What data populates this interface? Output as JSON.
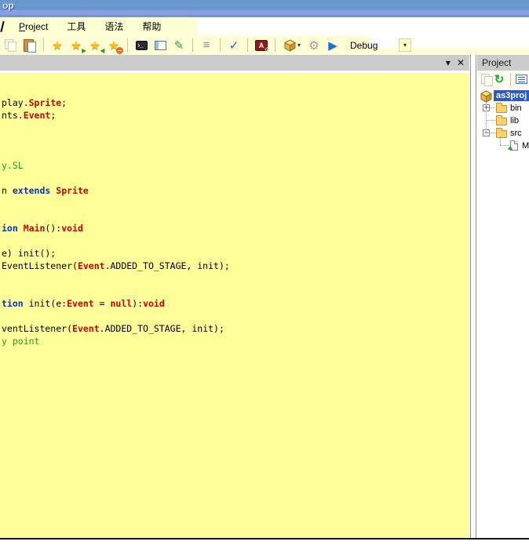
{
  "window": {
    "title": "op"
  },
  "colors": {
    "title_band": "#6898cc",
    "title_band_light": "#8d9de6",
    "bar_yellow": "#ffffd6",
    "editor_bg": "#ffff99",
    "selection_blue": "#2a5ac8",
    "keyword": "#0033cc",
    "type": "#c80000",
    "comment": "#22a022",
    "panel_gray": "#cbcbcb"
  },
  "menu": {
    "items": [
      {
        "name": "menu-item-project",
        "label": "Project",
        "underline": 0
      },
      {
        "name": "menu-item-tools",
        "label": "工具"
      },
      {
        "name": "menu-item-syntax",
        "label": "语法"
      },
      {
        "name": "menu-item-help",
        "label": "帮助"
      }
    ]
  },
  "toolbar": {
    "items": [
      {
        "name": "copy-icon",
        "kind": "copy",
        "disabled": true
      },
      {
        "name": "paste-icon",
        "kind": "paste"
      },
      {
        "name": "toolbar-separator",
        "kind": "sep"
      },
      {
        "name": "bookmark-icon",
        "kind": "star",
        "glyph": "★"
      },
      {
        "name": "next-bookmark-icon",
        "kind": "star",
        "glyph": "★",
        "overlay": "▸",
        "overlayColor": "#1fa01f"
      },
      {
        "name": "prev-bookmark-icon",
        "kind": "star",
        "glyph": "★",
        "overlay": "◂",
        "overlayColor": "#1fa01f"
      },
      {
        "name": "clear-bookmarks-icon",
        "kind": "star",
        "glyph": "★",
        "overlay": "−",
        "overlayColor": "#fff",
        "overlayBg": "#e86c1a"
      },
      {
        "name": "toolbar-separator",
        "kind": "sep"
      },
      {
        "name": "console-icon",
        "kind": "console",
        "glyph": "›_"
      },
      {
        "name": "layout-panels-icon",
        "kind": "layout"
      },
      {
        "name": "snippet-edit-icon",
        "kind": "glyph",
        "glyph": "✎",
        "color": "#3a9a3a"
      },
      {
        "name": "toolbar-separator",
        "kind": "sep"
      },
      {
        "name": "indent-icon",
        "kind": "glyph",
        "glyph": "≡",
        "color": "#8a8a8a"
      },
      {
        "name": "toolbar-separator",
        "kind": "sep"
      },
      {
        "name": "syntax-check-icon",
        "kind": "glyph",
        "glyph": "✓",
        "color": "#1b5fd0"
      },
      {
        "name": "toolbar-separator",
        "kind": "sep"
      },
      {
        "name": "flash-player-icon",
        "kind": "flash",
        "glyph": "A",
        "gear": "⚙"
      },
      {
        "name": "toolbar-separator",
        "kind": "sep"
      },
      {
        "name": "build-project-icon",
        "kind": "cube",
        "dropdown": "▾"
      },
      {
        "name": "settings-icon",
        "kind": "glyph",
        "glyph": "⚙",
        "color": "#9a9a9a"
      },
      {
        "name": "run-icon",
        "kind": "glyph",
        "glyph": "▶",
        "color": "#1b6fd0"
      }
    ],
    "debug_combo": {
      "value": "Debug",
      "arrow": "▾"
    }
  },
  "editor": {
    "header": {
      "collapse_glyph": "▾",
      "close_glyph": "✕"
    },
    "lines": [
      [
        [
          "p",
          "play."
        ],
        [
          "t",
          "Sprite"
        ],
        [
          "p",
          ";"
        ]
      ],
      [
        [
          "p",
          "nts."
        ],
        [
          "t",
          "Event"
        ],
        [
          "p",
          ";"
        ]
      ],
      [],
      [],
      [],
      [
        [
          "c",
          "y.SL"
        ]
      ],
      [],
      [
        [
          "p",
          "n "
        ],
        [
          "k",
          "extends"
        ],
        [
          "p",
          " "
        ],
        [
          "t",
          "Sprite"
        ]
      ],
      [],
      [],
      [
        [
          "k",
          "ion"
        ],
        [
          "p",
          " "
        ],
        [
          "t",
          "Main"
        ],
        [
          "p",
          "():"
        ],
        [
          "t",
          "void"
        ]
      ],
      [],
      [
        [
          "p",
          "e) init();"
        ]
      ],
      [
        [
          "p",
          "EventListener("
        ],
        [
          "t",
          "Event"
        ],
        [
          "p",
          ".ADDED_TO_STAGE, init);"
        ]
      ],
      [],
      [],
      [
        [
          "k",
          "tion"
        ],
        [
          "p",
          " init(e:"
        ],
        [
          "t",
          "Event"
        ],
        [
          "p",
          " = "
        ],
        [
          "t",
          "null"
        ],
        [
          "p",
          "):"
        ],
        [
          "t",
          "void"
        ]
      ],
      [],
      [
        [
          "p",
          "ventListener("
        ],
        [
          "t",
          "Event"
        ],
        [
          "p",
          ".ADDED_TO_STAGE, init);"
        ]
      ],
      [
        [
          "c",
          "y point"
        ]
      ]
    ]
  },
  "project_panel": {
    "title": "Project",
    "toolbar": [
      {
        "name": "copy-path-icon",
        "kind": "copy",
        "disabled": true
      },
      {
        "name": "refresh-icon",
        "kind": "glyph",
        "glyph": "↻",
        "color": "#2fa02f",
        "bold": true
      },
      {
        "name": "toolbar-separator",
        "kind": "sep"
      },
      {
        "name": "project-properties-icon",
        "kind": "listblue"
      }
    ],
    "tree": [
      {
        "name": "tree-item-as3proj",
        "label": "as3proj",
        "icon": "cube",
        "level": 0,
        "selected": true
      },
      {
        "name": "tree-item-bin",
        "label": "bin",
        "icon": "folder",
        "level": 1,
        "expander": "+"
      },
      {
        "name": "tree-item-lib",
        "label": "lib",
        "icon": "folder",
        "level": 1
      },
      {
        "name": "tree-item-src",
        "label": "src",
        "icon": "folder",
        "level": 1,
        "expander": "−"
      },
      {
        "name": "tree-item-main",
        "label": "M",
        "icon": "file",
        "level": 2
      }
    ]
  }
}
